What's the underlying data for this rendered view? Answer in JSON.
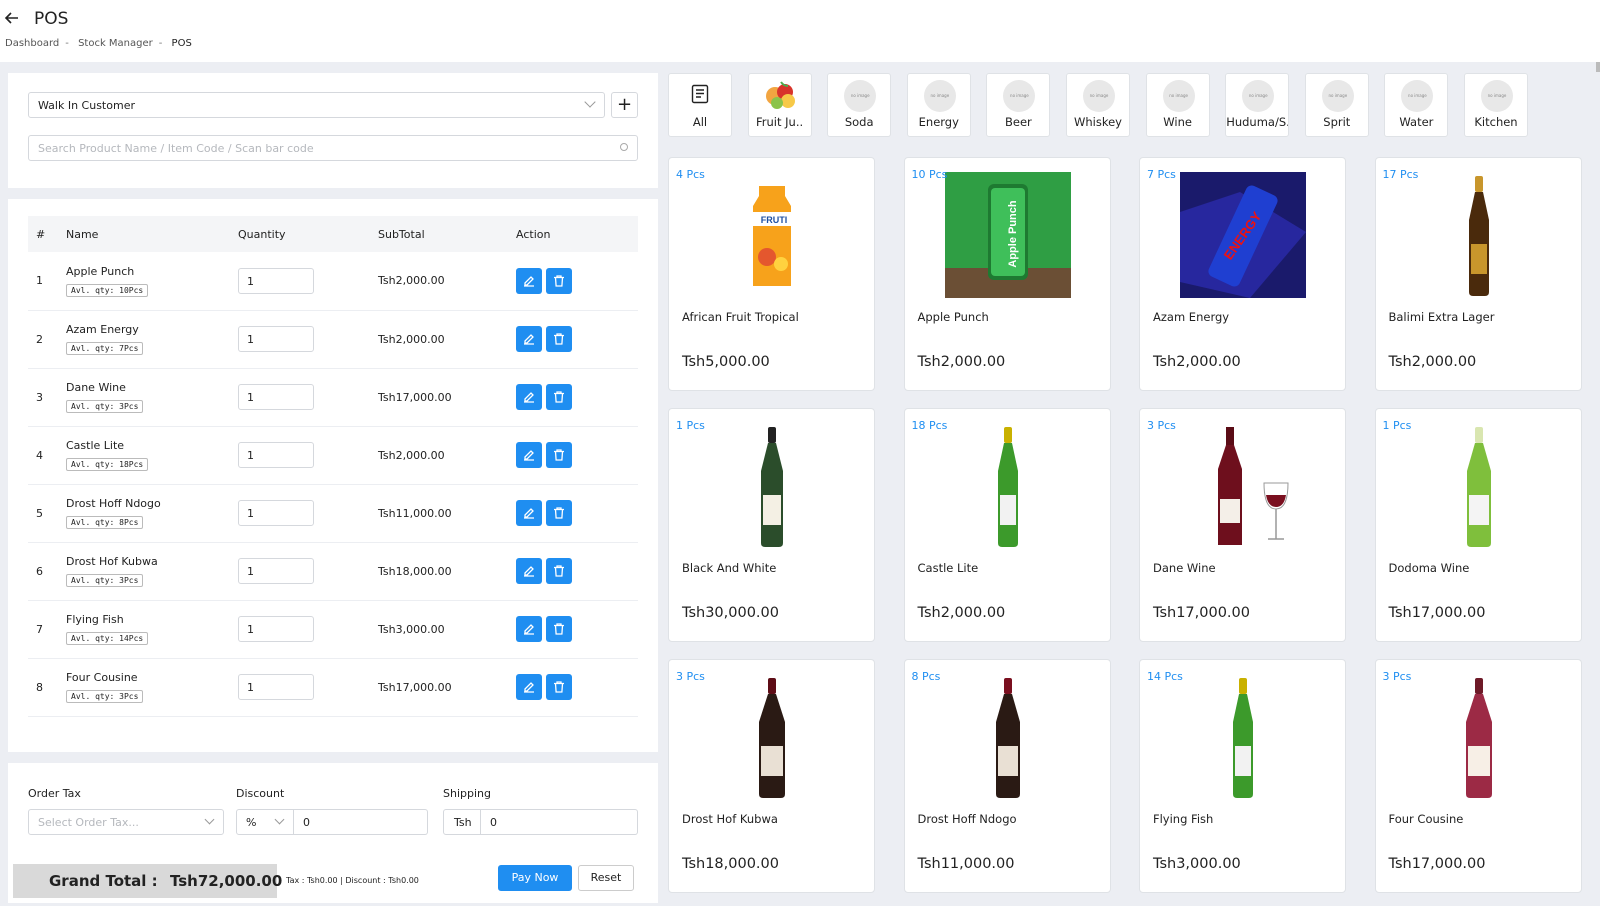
{
  "header": {
    "title": "POS",
    "breadcrumb": [
      "Dashboard",
      "Stock Manager",
      "POS"
    ]
  },
  "customer": {
    "selected": "Walk In Customer",
    "search_placeholder": "Search Product Name / Item Code / Scan bar code"
  },
  "cart": {
    "columns": [
      "#",
      "Name",
      "Quantity",
      "SubTotal",
      "Action"
    ],
    "rows": [
      {
        "n": "1",
        "name": "Apple Punch",
        "avl": "Avl. qty: 10Pcs",
        "qty": "1",
        "subtotal": "Tsh2,000.00"
      },
      {
        "n": "2",
        "name": "Azam Energy",
        "avl": "Avl. qty: 7Pcs",
        "qty": "1",
        "subtotal": "Tsh2,000.00"
      },
      {
        "n": "3",
        "name": "Dane Wine",
        "avl": "Avl. qty: 3Pcs",
        "qty": "1",
        "subtotal": "Tsh17,000.00"
      },
      {
        "n": "4",
        "name": "Castle Lite",
        "avl": "Avl. qty: 18Pcs",
        "qty": "1",
        "subtotal": "Tsh2,000.00"
      },
      {
        "n": "5",
        "name": "Drost Hoff Ndogo",
        "avl": "Avl. qty: 8Pcs",
        "qty": "1",
        "subtotal": "Tsh11,000.00"
      },
      {
        "n": "6",
        "name": "Drost Hof Kubwa",
        "avl": "Avl. qty: 3Pcs",
        "qty": "1",
        "subtotal": "Tsh18,000.00"
      },
      {
        "n": "7",
        "name": "Flying Fish",
        "avl": "Avl. qty: 14Pcs",
        "qty": "1",
        "subtotal": "Tsh3,000.00"
      },
      {
        "n": "8",
        "name": "Four Cousine",
        "avl": "Avl. qty: 3Pcs",
        "qty": "1",
        "subtotal": "Tsh17,000.00"
      }
    ]
  },
  "order": {
    "tax_label": "Order Tax",
    "tax_placeholder": "Select Order Tax...",
    "discount_label": "Discount",
    "discount_type": "%",
    "discount_value": "0",
    "shipping_label": "Shipping",
    "shipping_prefix": "Tsh",
    "shipping_value": "0"
  },
  "totals": {
    "grand_label": "Grand Total :",
    "grand_value": "Tsh72,000.00",
    "tax_discount": "Tax : Tsh0.00 | Discount : Tsh0.00",
    "pay_label": "Pay Now",
    "reset_label": "Reset"
  },
  "categories": [
    {
      "label": "All",
      "icon": "list-icon"
    },
    {
      "label": "Fruit Ju..",
      "icon": "fruit-image"
    },
    {
      "label": "Soda",
      "icon": "no-image"
    },
    {
      "label": "Energy",
      "icon": "no-image"
    },
    {
      "label": "Beer",
      "icon": "no-image"
    },
    {
      "label": "Whiskey",
      "icon": "no-image"
    },
    {
      "label": "Wine",
      "icon": "no-image"
    },
    {
      "label": "Huduma/S..",
      "icon": "no-image"
    },
    {
      "label": "Sprit",
      "icon": "no-image"
    },
    {
      "label": "Water",
      "icon": "no-image"
    },
    {
      "label": "Kitchen",
      "icon": "no-image"
    }
  ],
  "no_image_text": "no image",
  "products": [
    {
      "pcs": "4 Pcs",
      "name": "African Fruit Tropical",
      "price": "Tsh5,000.00",
      "img": "juice-carton"
    },
    {
      "pcs": "10 Pcs",
      "name": "Apple Punch",
      "price": "Tsh2,000.00",
      "img": "green-can"
    },
    {
      "pcs": "7 Pcs",
      "name": "Azam Energy",
      "price": "Tsh2,000.00",
      "img": "energy-can"
    },
    {
      "pcs": "17 Pcs",
      "name": "Balimi Extra Lager",
      "price": "Tsh2,000.00",
      "img": "brown-bottle"
    },
    {
      "pcs": "1 Pcs",
      "name": "Black And White",
      "price": "Tsh30,000.00",
      "img": "whisky-bottle"
    },
    {
      "pcs": "18 Pcs",
      "name": "Castle Lite",
      "price": "Tsh2,000.00",
      "img": "green-bottle"
    },
    {
      "pcs": "3 Pcs",
      "name": "Dane Wine",
      "price": "Tsh17,000.00",
      "img": "red-wine"
    },
    {
      "pcs": "1 Pcs",
      "name": "Dodoma Wine",
      "price": "Tsh17,000.00",
      "img": "white-wine"
    },
    {
      "pcs": "3 Pcs",
      "name": "Drost Hof Kubwa",
      "price": "Tsh18,000.00",
      "img": "dark-wine"
    },
    {
      "pcs": "8 Pcs",
      "name": "Drost Hoff Ndogo",
      "price": "Tsh11,000.00",
      "img": "dark-wine-small"
    },
    {
      "pcs": "14 Pcs",
      "name": "Flying Fish",
      "price": "Tsh3,000.00",
      "img": "green-bottle"
    },
    {
      "pcs": "3 Pcs",
      "name": "Four Cousine",
      "price": "Tsh17,000.00",
      "img": "pink-wine"
    }
  ],
  "colors": {
    "accent": "#1f8ef1",
    "background": "#eceef3"
  }
}
